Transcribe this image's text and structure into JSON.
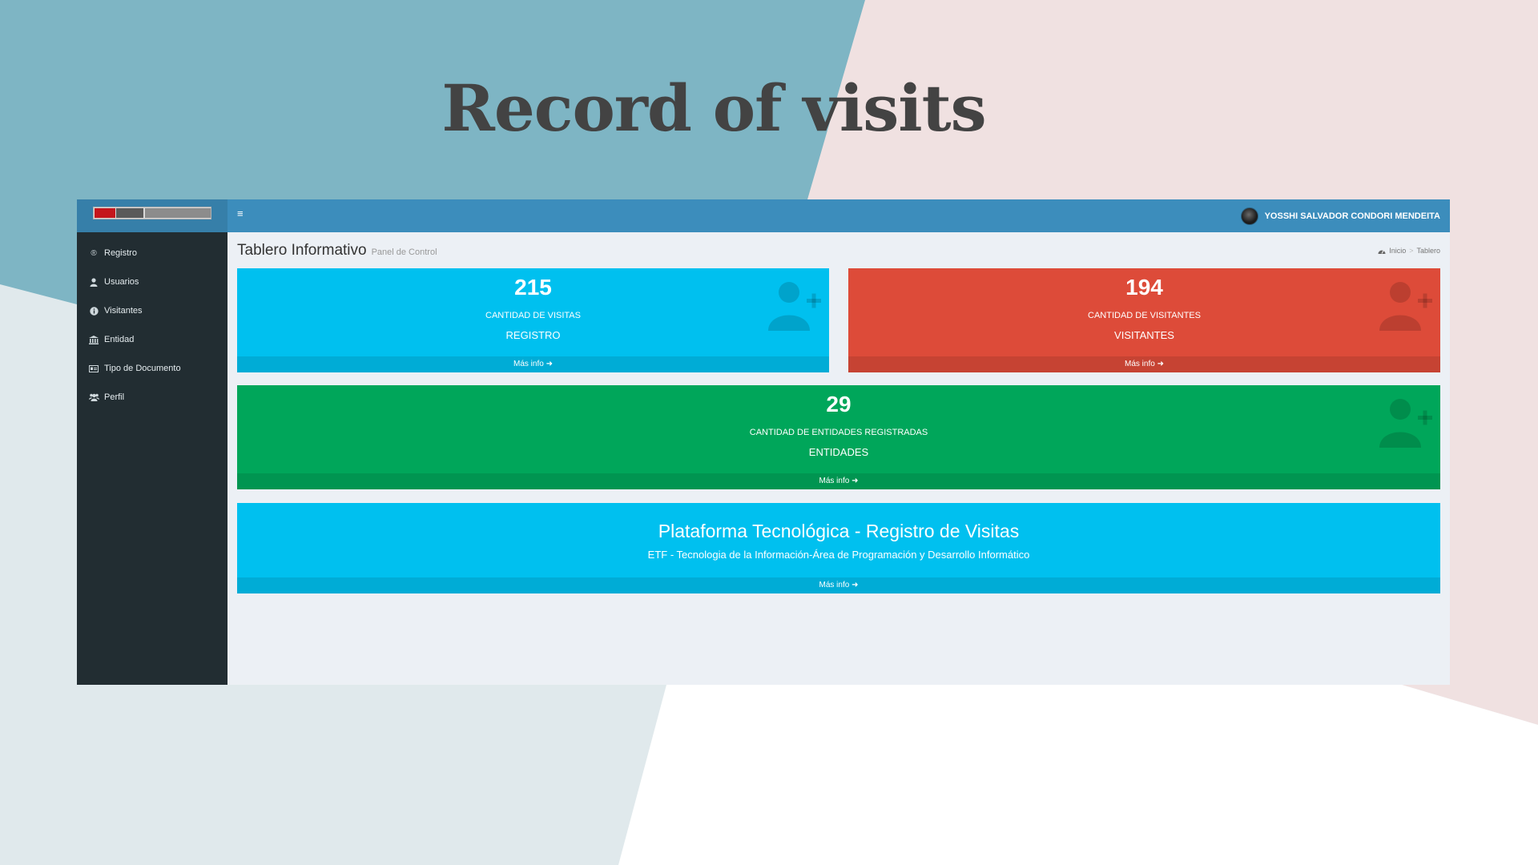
{
  "slide": {
    "title": "Record of visits"
  },
  "colors": {
    "topbar": "#3c8dbc",
    "sidebar": "#222d32",
    "aqua": "#00c0ef",
    "red": "#dd4b39",
    "green": "#00a65a"
  },
  "header": {
    "menu_icon": "hamburger-icon",
    "user_name": "YOSSHI SALVADOR CONDORI MENDEITA"
  },
  "sidebar": {
    "items": [
      {
        "label": "Registro",
        "icon": "registered-icon"
      },
      {
        "label": "Usuarios",
        "icon": "user-icon"
      },
      {
        "label": "Visitantes",
        "icon": "info-circle-icon"
      },
      {
        "label": "Entidad",
        "icon": "institution-icon"
      },
      {
        "label": "Tipo de Documento",
        "icon": "id-card-icon"
      },
      {
        "label": "Perfil",
        "icon": "users-icon"
      }
    ]
  },
  "page": {
    "title": "Tablero Informativo",
    "subtitle": "Panel de Control",
    "breadcrumb": [
      "Inicio",
      "Tablero"
    ]
  },
  "boxes": [
    {
      "value": "215",
      "label": "CANTIDAD DE VISITAS",
      "sub": "REGISTRO",
      "footer": "Más info",
      "color": "aqua"
    },
    {
      "value": "194",
      "label": "CANTIDAD DE VISITANTES",
      "sub": "VISITANTES",
      "footer": "Más info",
      "color": "red"
    },
    {
      "value": "29",
      "label": "CANTIDAD DE ENTIDADES REGISTRADAS",
      "sub": "ENTIDADES",
      "footer": "Más info",
      "color": "green"
    }
  ],
  "banner": {
    "title": "Plataforma Tecnológica - Registro de Visitas",
    "subtitle": "ETF - Tecnologia de la Información-Área de Programación y Desarrollo Informático",
    "footer": "Más info"
  }
}
